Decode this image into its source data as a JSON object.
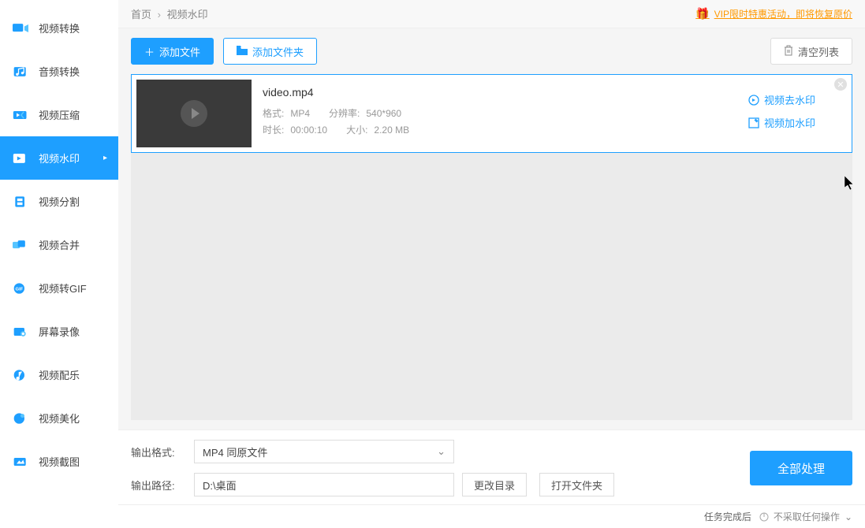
{
  "sidebar": {
    "items": [
      {
        "label": "视频转换"
      },
      {
        "label": "音频转换"
      },
      {
        "label": "视频压缩"
      },
      {
        "label": "视频水印"
      },
      {
        "label": "视频分割"
      },
      {
        "label": "视频合并"
      },
      {
        "label": "视频转GIF"
      },
      {
        "label": "屏幕录像"
      },
      {
        "label": "视频配乐"
      },
      {
        "label": "视频美化"
      },
      {
        "label": "视频截图"
      }
    ]
  },
  "header": {
    "home": "首页",
    "current": "视频水印",
    "vip_text": "VIP限时特惠活动，即将恢复原价"
  },
  "toolbar": {
    "add_file": "添加文件",
    "add_folder": "添加文件夹",
    "clear_list": "清空列表"
  },
  "item": {
    "title": "video.mp4",
    "format_label": "格式:",
    "format_value": "MP4",
    "resolution_label": "分辨率:",
    "resolution_value": "540*960",
    "duration_label": "时长:",
    "duration_value": "00:00:10",
    "size_label": "大小:",
    "size_value": "2.20 MB",
    "action_remove_wm": "视频去水印",
    "action_add_wm": "视频加水印"
  },
  "bottom": {
    "format_label": "输出格式:",
    "format_value": "MP4  同原文件",
    "path_label": "输出路径:",
    "path_value": "D:\\桌面",
    "change_dir": "更改目录",
    "open_folder": "打开文件夹",
    "process_all": "全部处理"
  },
  "status": {
    "label": "任务完成后",
    "action": "不采取任何操作"
  }
}
